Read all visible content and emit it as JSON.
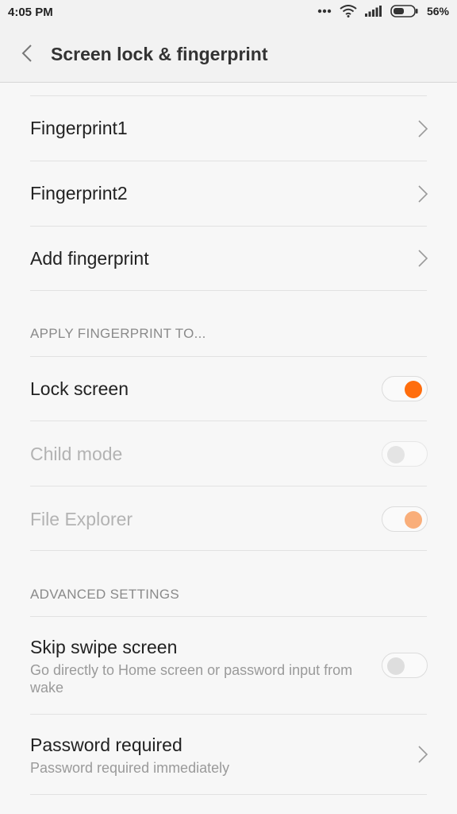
{
  "status_bar": {
    "time": "4:05 PM",
    "battery_percent": "56%",
    "battery_level": 0.56,
    "icons": [
      "more-dots-icon",
      "wifi-icon",
      "signal-icon",
      "battery-icon"
    ]
  },
  "header": {
    "title": "Screen lock & fingerprint",
    "back_icon": "chevron-left-icon"
  },
  "fingerprints": {
    "items": [
      {
        "label": "Fingerprint1"
      },
      {
        "label": "Fingerprint2"
      },
      {
        "label": "Add fingerprint"
      }
    ]
  },
  "apply_section": {
    "header": "APPLY FINGERPRINT TO...",
    "items": [
      {
        "label": "Lock screen",
        "enabled": true,
        "checked": true
      },
      {
        "label": "Child mode",
        "enabled": false,
        "checked": false
      },
      {
        "label": "File Explorer",
        "enabled": false,
        "checked": true
      }
    ]
  },
  "advanced_section": {
    "header": "ADVANCED SETTINGS",
    "skip_swipe": {
      "label": "Skip swipe screen",
      "subtitle": "Go directly to Home screen or password input from wake",
      "checked": false
    },
    "password_required": {
      "label": "Password required",
      "subtitle": "Password required immediately"
    }
  },
  "colors": {
    "accent": "#ff6d0d",
    "accent_disabled": "#f9ae7a",
    "background": "#f7f7f7"
  }
}
